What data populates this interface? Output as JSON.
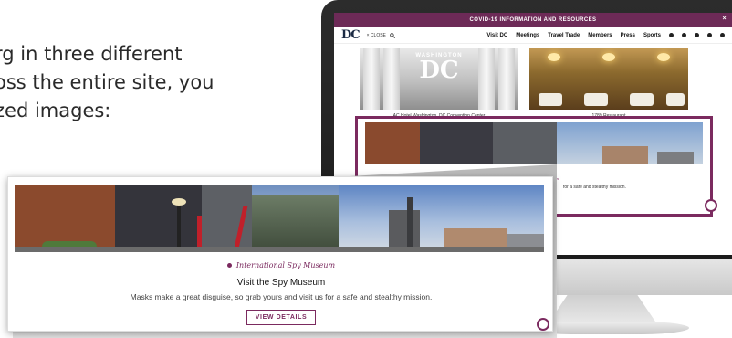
{
  "intro": {
    "lines": [
      "rg in three different",
      "oss the entire site, you",
      "zed images:"
    ]
  },
  "monitor": {
    "covid_bar": "COVID-19 INFORMATION AND RESOURCES",
    "covid_close": "×",
    "logo": "DC",
    "close_label": "× CLOSE",
    "nav": [
      "Visit DC",
      "Meetings",
      "Travel Trade",
      "Members",
      "Press",
      "Sports"
    ],
    "cards": [
      {
        "caption": "AC Hotel Washington, DC Convention Center",
        "overlay_small": "WASHINGTON",
        "overlay_big": "DC"
      },
      {
        "caption": "1789 Restaurant"
      }
    ],
    "highlight": {
      "tag": "International Spy Museum",
      "desc": "for a safe and stealthy mission."
    }
  },
  "zoom": {
    "tag": "International Spy Museum",
    "title": "Visit the Spy Museum",
    "desc": "Masks make a great disguise, so grab yours and visit us for a safe and stealthy mission.",
    "button": "VIEW DETAILS"
  },
  "colors": {
    "brand_purple": "#7b2a5f",
    "covid_bar": "#6d2a57",
    "navy": "#1b2a44"
  }
}
